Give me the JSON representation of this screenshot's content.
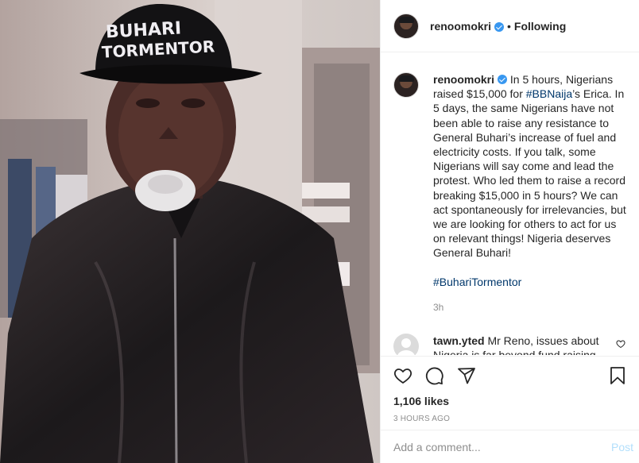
{
  "post": {
    "image": {
      "cap_text_line1": "BUHARI",
      "cap_text_line2": "TORMENTOR"
    }
  },
  "header": {
    "username": "renoomokri",
    "separator": "•",
    "follow_status": "Following"
  },
  "caption": {
    "username": "renoomokri",
    "text_part1": "In 5 hours, Nigerians raised $15,000 for ",
    "hashtag1": "#BBNaija",
    "text_part2": "’s Erica. In 5 days, the same Nigerians have not been able to raise any resistance to General Buhari’s increase of fuel and electricity costs. If you talk, some Nigerians will say come and lead the protest. Who led them to raise a record breaking $15,000 in 5 hours? We can act spontaneously for irrelevancies, but we are looking for others to act for us on relevant things! Nigeria deserves General Buhari!",
    "hashtag2": "#BuhariTormentor",
    "time_ago": "3h"
  },
  "comments": [
    {
      "username": "tawn.yted",
      "text": "Mr Reno, issues about Nigeria is far beyond fund raising"
    }
  ],
  "actions": {
    "likes": "1,106 likes",
    "posted": "3 HOURS AGO"
  },
  "add_comment": {
    "placeholder": "Add a comment...",
    "post_label": "Post"
  },
  "icons": [
    "heart-icon",
    "comment-icon",
    "share-icon",
    "bookmark-icon",
    "verified-badge-icon"
  ],
  "colors": {
    "link": "#00376b",
    "verified": "#3897f0",
    "muted": "#8e8e8e",
    "post_disabled": "#b2dffc"
  }
}
